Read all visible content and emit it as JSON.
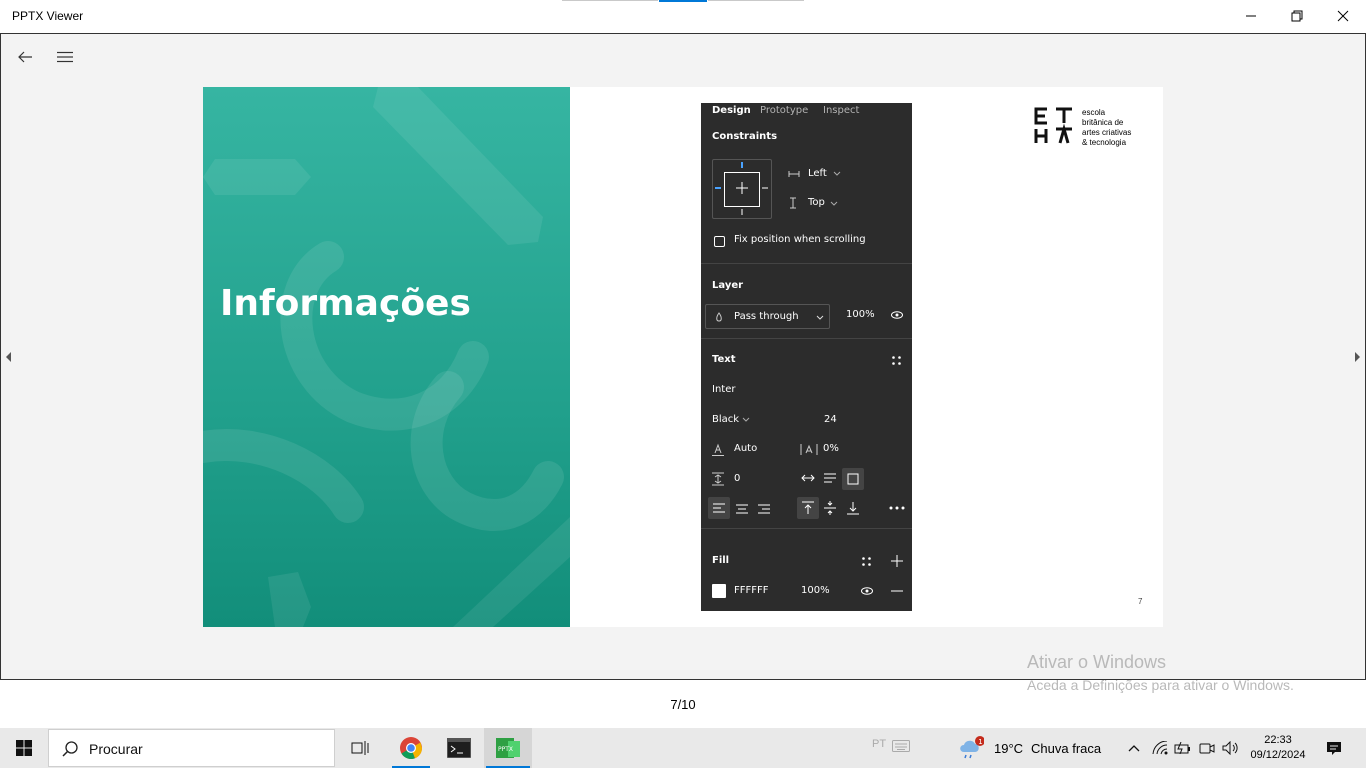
{
  "window": {
    "title": "PPTX Viewer"
  },
  "slide": {
    "heading": "Informações",
    "page_number": "7",
    "logo_lines": [
      "escola",
      "britânica de",
      "artes criativas",
      "& tecnologia"
    ],
    "panel": {
      "tabs": [
        "Design",
        "Prototype",
        "Inspect"
      ],
      "constraints_title": "Constraints",
      "horizontal_constraint": "Left",
      "vertical_constraint": "Top",
      "fix_position_label": "Fix position when scrolling",
      "layer_title": "Layer",
      "blend_mode": "Pass through",
      "layer_opacity": "100%",
      "text_title": "Text",
      "font_family": "Inter",
      "font_weight": "Black",
      "font_size": "24",
      "line_height": "Auto",
      "letter_spacing": "0%",
      "paragraph_spacing": "0",
      "fill_title": "Fill",
      "fill_hex": "FFFFFF",
      "fill_opacity": "100%"
    }
  },
  "watermark": {
    "title": "Ativar o Windows",
    "subtitle": "Aceda a Definições para ativar o Windows."
  },
  "pager": {
    "indicator": "7/10"
  },
  "taskbar": {
    "search_placeholder": "Procurar",
    "input_language": "PT",
    "temperature": "19°C",
    "weather": "Chuva fraca",
    "weather_badge": "1",
    "time": "22:33",
    "date": "09/12/2024"
  },
  "colors": {
    "slide_green": "#21a08c",
    "panel_bg": "#2c2c2c",
    "accent": "#0078d7"
  }
}
